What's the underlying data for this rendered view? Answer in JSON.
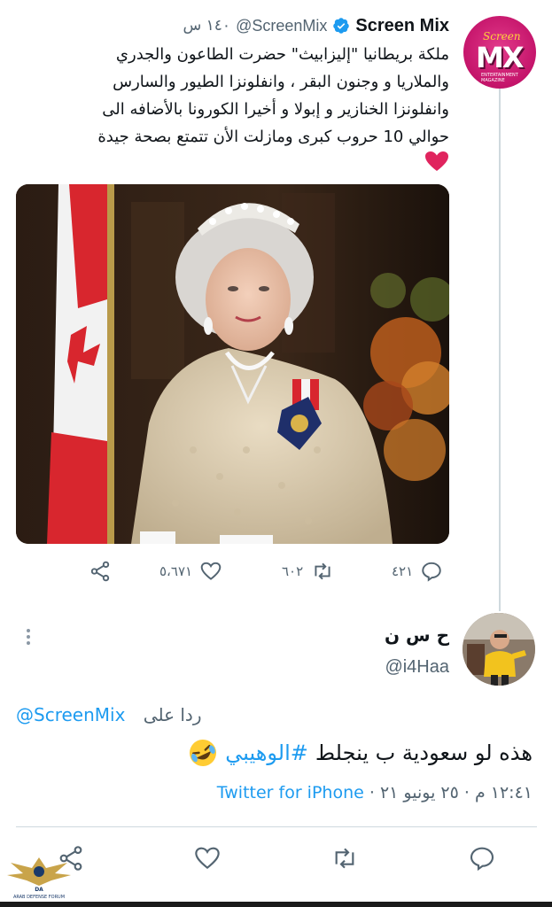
{
  "tweet": {
    "display_name": "Screen Mix",
    "handle": "@ScreenMix",
    "time": "١٤٠ س",
    "avatar_text": "MX",
    "avatar_script": "Screen",
    "avatar_tagline": "ENTERTAINMENT MAGAZINE",
    "text_lines": [
      "ملكة بريطانيا \"إليزابيث\" حضرت الطاعون والجدري",
      "والملاريا و وجنون البقر ، وانفلونزا الطيور والسارس",
      "وانفلونزا الخنازير و إبولا و أخيرا الكورونا بالأضافه الى",
      "حوالي 10 حروب كبرى ومازلت الأن تتمتع بصحة جيدة"
    ],
    "heart_emoji": "heart-emoji",
    "actions": {
      "reply_count": "٤٢١",
      "retweet_count": "٦٠٢",
      "like_count": "٥،٦٧١"
    }
  },
  "reply": {
    "display_name": "ح س ن",
    "handle": "@i4Haa",
    "replying_to_prefix": "ردا على",
    "replying_to_handle": "@ScreenMix",
    "text": "هذه لو سعودية ب ينجلط",
    "hashtag": "#الوهيبي",
    "emoji": "rofl-emoji",
    "timestamp": "١٢:٤١ م · ٢٥ يونيو ٢١ ·",
    "source": "Twitter for iPhone"
  },
  "watermark": {
    "text": "ARAB DEFENSE FORUM",
    "sub": "DA"
  },
  "colors": {
    "accent": "#1d9bf0",
    "secondary": "#536471",
    "like_heart": "#e0245e"
  }
}
